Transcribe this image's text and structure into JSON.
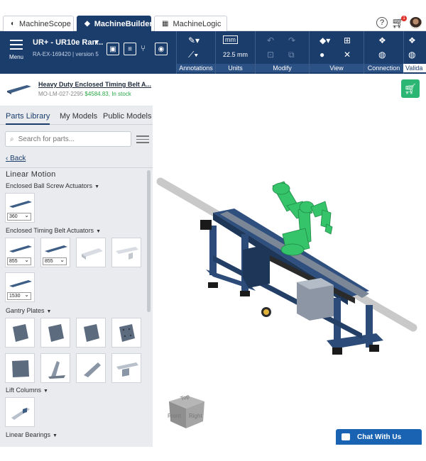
{
  "tabs": {
    "scope": "MachineScope",
    "builder": "MachineBuilder",
    "logic": "MachineLogic"
  },
  "header": {
    "help": "?",
    "cart_badge": "1"
  },
  "toolbar": {
    "menu_label": "Menu",
    "project_title": "UR+ - UR10e Ran...",
    "project_sub": "RA-EX-169420 | version 5",
    "units_unit": "mm",
    "units_value": "22.5 mm",
    "groups": {
      "annotations": "Annotations",
      "units": "Units",
      "modify": "Modify",
      "view": "View",
      "connection": "Connection",
      "validate": "Valida"
    }
  },
  "product": {
    "name": "Heavy Duty Enclosed Timing Belt A...",
    "id": "MO-LM-027-2295",
    "price": "$4584.83,",
    "stock": "In stock"
  },
  "panel": {
    "tabs": {
      "parts": "Parts Library",
      "models": "My Models",
      "public": "Public Models"
    },
    "search_placeholder": "Search for parts...",
    "back": "Back",
    "section": "Linear Motion",
    "categories": {
      "ball_screw": "Enclosed Ball Screw Actuators",
      "timing_belt": "Enclosed Timing Belt Actuators",
      "gantry": "Gantry Plates",
      "lift": "Lift Columns",
      "bearings": "Linear Bearings"
    },
    "selects": {
      "bs1": "360",
      "tb1": "855",
      "tb2": "855",
      "tb3": "1530"
    }
  },
  "viewport": {
    "cube_top": "Top",
    "cube_front": "Front",
    "cube_right": "Right",
    "chat": "Chat With Us"
  },
  "colors": {
    "navy": "#1b3d6b",
    "green": "#2bb673",
    "chat": "#1a63b3",
    "robot": "#36c46a"
  }
}
